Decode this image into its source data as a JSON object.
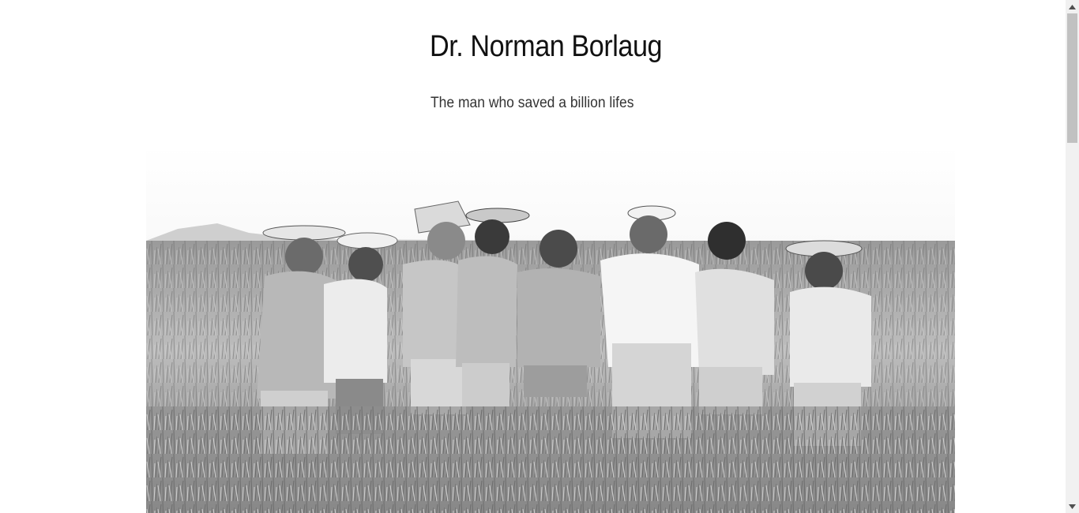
{
  "header": {
    "title": "Dr. Norman Borlaug",
    "subtitle": "The man who saved a billion lifes"
  },
  "photo": {
    "content": "Black and white photograph of eight men in hats standing in a wheat field",
    "style": "grayscale"
  },
  "scrollbar": {
    "up_icon": "arrow-up-icon",
    "down_icon": "arrow-down-icon",
    "scroll_position_fraction": 0.0
  },
  "colors": {
    "background": "#ffffff",
    "title_text": "#111111",
    "subtitle_text": "#333333",
    "scrollbar_track": "#f1f1f1",
    "scrollbar_thumb": "#c1c1c1"
  }
}
